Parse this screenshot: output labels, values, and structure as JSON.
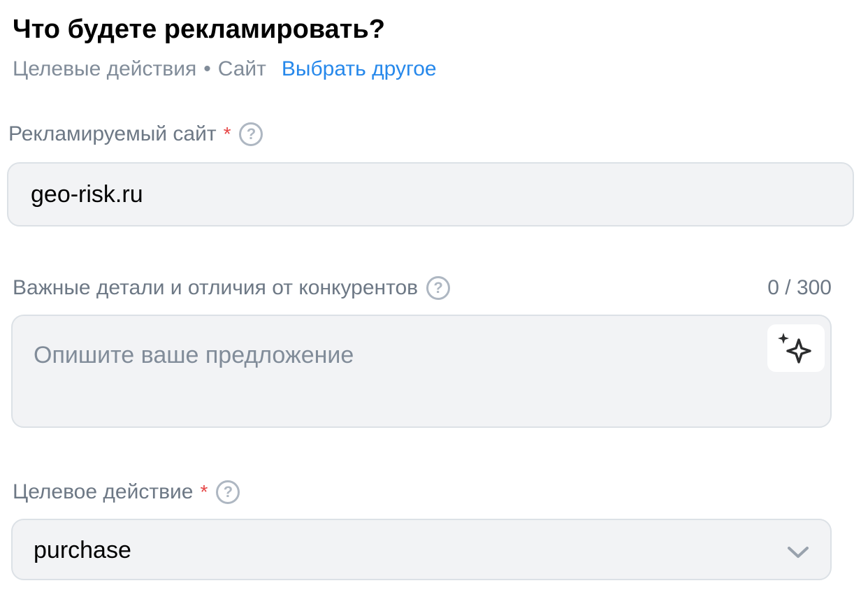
{
  "header": {
    "title": "Что будете рекламировать?",
    "subtitle_part1": "Целевые действия",
    "subtitle_separator": "•",
    "subtitle_part2": "Сайт",
    "change_link": "Выбрать другое"
  },
  "site_field": {
    "label": "Рекламируемый сайт",
    "required_mark": "*",
    "help_glyph": "?",
    "value": "geo-risk.ru"
  },
  "details_field": {
    "label": "Важные детали и отличия от конкурентов",
    "help_glyph": "?",
    "counter": "0 / 300",
    "placeholder": "Опишите ваше предложение",
    "value": "",
    "ai_icon": "sparkles-icon"
  },
  "action_field": {
    "label": "Целевое действие",
    "required_mark": "*",
    "help_glyph": "?",
    "selected": "purchase",
    "dropdown_icon": "chevron-down-icon"
  },
  "colors": {
    "link": "#2688eb",
    "required": "#e64646",
    "field_bg": "#f2f3f5",
    "field_border": "#dce1e6",
    "secondary_text": "#818c99"
  }
}
